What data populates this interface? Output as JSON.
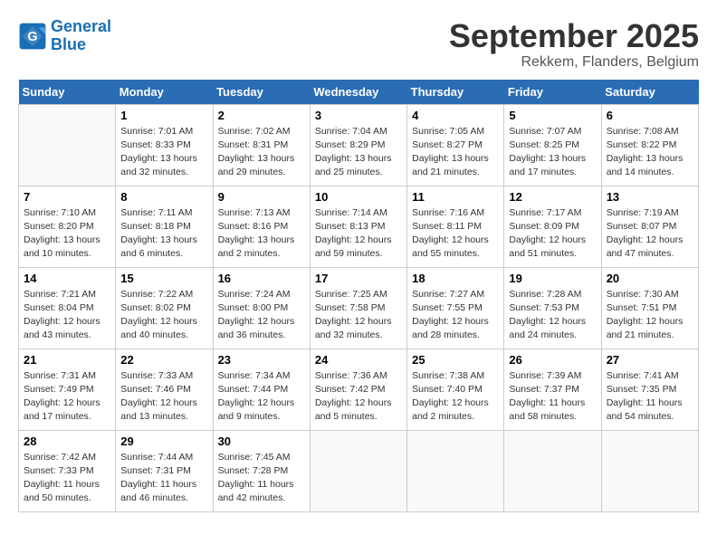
{
  "header": {
    "logo_line1": "General",
    "logo_line2": "Blue",
    "month": "September 2025",
    "location": "Rekkem, Flanders, Belgium"
  },
  "weekdays": [
    "Sunday",
    "Monday",
    "Tuesday",
    "Wednesday",
    "Thursday",
    "Friday",
    "Saturday"
  ],
  "weeks": [
    [
      {
        "day": "",
        "sunrise": "",
        "sunset": "",
        "daylight": ""
      },
      {
        "day": "1",
        "sunrise": "Sunrise: 7:01 AM",
        "sunset": "Sunset: 8:33 PM",
        "daylight": "Daylight: 13 hours and 32 minutes."
      },
      {
        "day": "2",
        "sunrise": "Sunrise: 7:02 AM",
        "sunset": "Sunset: 8:31 PM",
        "daylight": "Daylight: 13 hours and 29 minutes."
      },
      {
        "day": "3",
        "sunrise": "Sunrise: 7:04 AM",
        "sunset": "Sunset: 8:29 PM",
        "daylight": "Daylight: 13 hours and 25 minutes."
      },
      {
        "day": "4",
        "sunrise": "Sunrise: 7:05 AM",
        "sunset": "Sunset: 8:27 PM",
        "daylight": "Daylight: 13 hours and 21 minutes."
      },
      {
        "day": "5",
        "sunrise": "Sunrise: 7:07 AM",
        "sunset": "Sunset: 8:25 PM",
        "daylight": "Daylight: 13 hours and 17 minutes."
      },
      {
        "day": "6",
        "sunrise": "Sunrise: 7:08 AM",
        "sunset": "Sunset: 8:22 PM",
        "daylight": "Daylight: 13 hours and 14 minutes."
      }
    ],
    [
      {
        "day": "7",
        "sunrise": "Sunrise: 7:10 AM",
        "sunset": "Sunset: 8:20 PM",
        "daylight": "Daylight: 13 hours and 10 minutes."
      },
      {
        "day": "8",
        "sunrise": "Sunrise: 7:11 AM",
        "sunset": "Sunset: 8:18 PM",
        "daylight": "Daylight: 13 hours and 6 minutes."
      },
      {
        "day": "9",
        "sunrise": "Sunrise: 7:13 AM",
        "sunset": "Sunset: 8:16 PM",
        "daylight": "Daylight: 13 hours and 2 minutes."
      },
      {
        "day": "10",
        "sunrise": "Sunrise: 7:14 AM",
        "sunset": "Sunset: 8:13 PM",
        "daylight": "Daylight: 12 hours and 59 minutes."
      },
      {
        "day": "11",
        "sunrise": "Sunrise: 7:16 AM",
        "sunset": "Sunset: 8:11 PM",
        "daylight": "Daylight: 12 hours and 55 minutes."
      },
      {
        "day": "12",
        "sunrise": "Sunrise: 7:17 AM",
        "sunset": "Sunset: 8:09 PM",
        "daylight": "Daylight: 12 hours and 51 minutes."
      },
      {
        "day": "13",
        "sunrise": "Sunrise: 7:19 AM",
        "sunset": "Sunset: 8:07 PM",
        "daylight": "Daylight: 12 hours and 47 minutes."
      }
    ],
    [
      {
        "day": "14",
        "sunrise": "Sunrise: 7:21 AM",
        "sunset": "Sunset: 8:04 PM",
        "daylight": "Daylight: 12 hours and 43 minutes."
      },
      {
        "day": "15",
        "sunrise": "Sunrise: 7:22 AM",
        "sunset": "Sunset: 8:02 PM",
        "daylight": "Daylight: 12 hours and 40 minutes."
      },
      {
        "day": "16",
        "sunrise": "Sunrise: 7:24 AM",
        "sunset": "Sunset: 8:00 PM",
        "daylight": "Daylight: 12 hours and 36 minutes."
      },
      {
        "day": "17",
        "sunrise": "Sunrise: 7:25 AM",
        "sunset": "Sunset: 7:58 PM",
        "daylight": "Daylight: 12 hours and 32 minutes."
      },
      {
        "day": "18",
        "sunrise": "Sunrise: 7:27 AM",
        "sunset": "Sunset: 7:55 PM",
        "daylight": "Daylight: 12 hours and 28 minutes."
      },
      {
        "day": "19",
        "sunrise": "Sunrise: 7:28 AM",
        "sunset": "Sunset: 7:53 PM",
        "daylight": "Daylight: 12 hours and 24 minutes."
      },
      {
        "day": "20",
        "sunrise": "Sunrise: 7:30 AM",
        "sunset": "Sunset: 7:51 PM",
        "daylight": "Daylight: 12 hours and 21 minutes."
      }
    ],
    [
      {
        "day": "21",
        "sunrise": "Sunrise: 7:31 AM",
        "sunset": "Sunset: 7:49 PM",
        "daylight": "Daylight: 12 hours and 17 minutes."
      },
      {
        "day": "22",
        "sunrise": "Sunrise: 7:33 AM",
        "sunset": "Sunset: 7:46 PM",
        "daylight": "Daylight: 12 hours and 13 minutes."
      },
      {
        "day": "23",
        "sunrise": "Sunrise: 7:34 AM",
        "sunset": "Sunset: 7:44 PM",
        "daylight": "Daylight: 12 hours and 9 minutes."
      },
      {
        "day": "24",
        "sunrise": "Sunrise: 7:36 AM",
        "sunset": "Sunset: 7:42 PM",
        "daylight": "Daylight: 12 hours and 5 minutes."
      },
      {
        "day": "25",
        "sunrise": "Sunrise: 7:38 AM",
        "sunset": "Sunset: 7:40 PM",
        "daylight": "Daylight: 12 hours and 2 minutes."
      },
      {
        "day": "26",
        "sunrise": "Sunrise: 7:39 AM",
        "sunset": "Sunset: 7:37 PM",
        "daylight": "Daylight: 11 hours and 58 minutes."
      },
      {
        "day": "27",
        "sunrise": "Sunrise: 7:41 AM",
        "sunset": "Sunset: 7:35 PM",
        "daylight": "Daylight: 11 hours and 54 minutes."
      }
    ],
    [
      {
        "day": "28",
        "sunrise": "Sunrise: 7:42 AM",
        "sunset": "Sunset: 7:33 PM",
        "daylight": "Daylight: 11 hours and 50 minutes."
      },
      {
        "day": "29",
        "sunrise": "Sunrise: 7:44 AM",
        "sunset": "Sunset: 7:31 PM",
        "daylight": "Daylight: 11 hours and 46 minutes."
      },
      {
        "day": "30",
        "sunrise": "Sunrise: 7:45 AM",
        "sunset": "Sunset: 7:28 PM",
        "daylight": "Daylight: 11 hours and 42 minutes."
      },
      {
        "day": "",
        "sunrise": "",
        "sunset": "",
        "daylight": ""
      },
      {
        "day": "",
        "sunrise": "",
        "sunset": "",
        "daylight": ""
      },
      {
        "day": "",
        "sunrise": "",
        "sunset": "",
        "daylight": ""
      },
      {
        "day": "",
        "sunrise": "",
        "sunset": "",
        "daylight": ""
      }
    ]
  ]
}
